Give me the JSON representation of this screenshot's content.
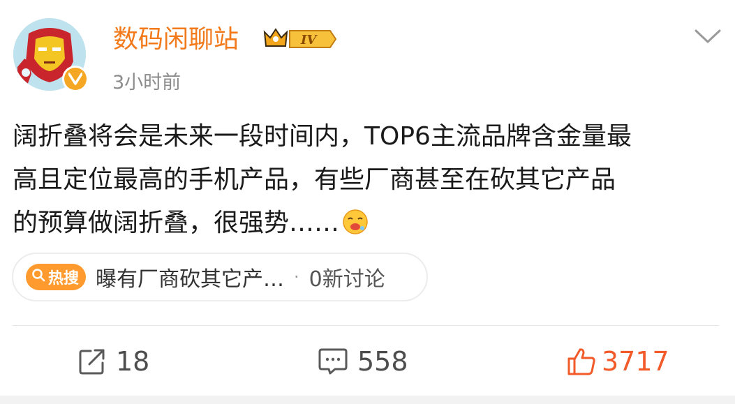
{
  "post": {
    "author": {
      "name": "数码闲聊站",
      "level_badge": "IV",
      "avatar_icon": "ironman-avatar",
      "verified_icon": "verified-v-icon",
      "verified_letter": "V"
    },
    "timestamp": "3小时前",
    "content_lines": [
      "阔折叠将会是未来一段时间内，TOP6主流品牌含金量最",
      "高且定位最高的手机产品，有些厂商甚至在砍其它产品",
      "的预算做阔折叠，很强势……"
    ],
    "topic": {
      "tag": "热搜",
      "title": "曝有厂商砍其它产…",
      "separator": "·",
      "discussion": "0新讨论"
    },
    "actions": {
      "share_count": "18",
      "comment_count": "558",
      "like_count": "3717"
    }
  },
  "colors": {
    "username": "#f27a1a",
    "like_active": "#f25a2a",
    "hot_tag": "#ff9a2e",
    "timestamp": "#8c8c8c"
  }
}
